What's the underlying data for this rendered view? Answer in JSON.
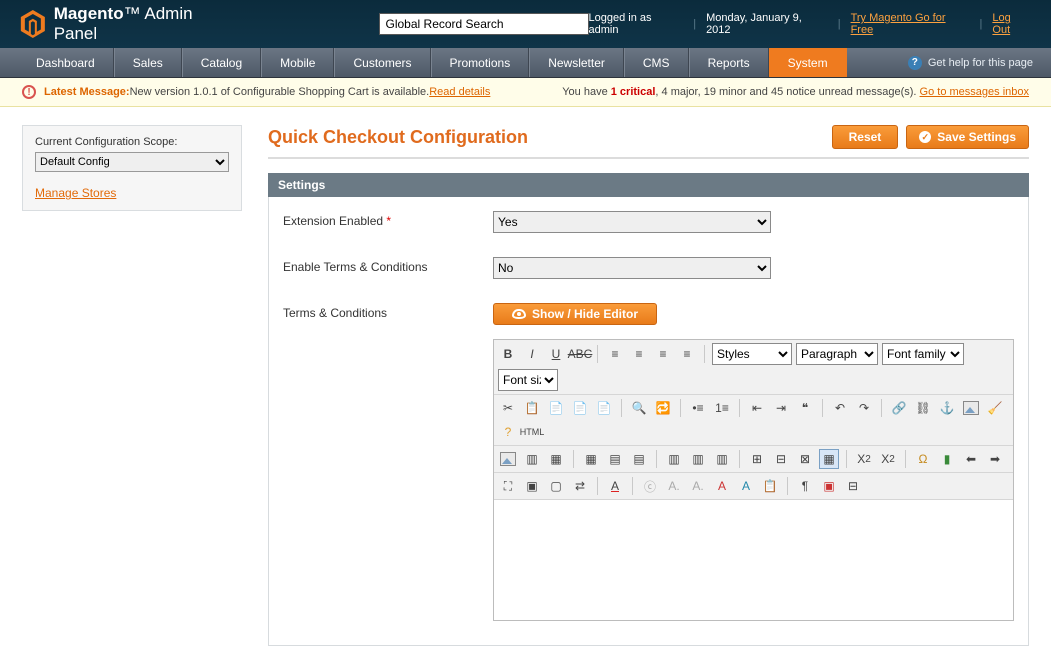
{
  "header": {
    "brand_a": "Magento",
    "brand_b": "Admin Panel",
    "search_placeholder": "Global Record Search",
    "logged_in": "Logged in as admin",
    "date": "Monday, January 9, 2012",
    "try_link": "Try Magento Go for Free",
    "logout": "Log Out"
  },
  "nav": {
    "items": [
      "Dashboard",
      "Sales",
      "Catalog",
      "Mobile",
      "Customers",
      "Promotions",
      "Newsletter",
      "CMS",
      "Reports",
      "System"
    ],
    "active_index": 9,
    "help": "Get help for this page"
  },
  "notice": {
    "prefix": "Latest Message:",
    "msg": " New version 1.0.1 of Configurable Shopping Cart is available. ",
    "details": "Read details",
    "you_have": "You have ",
    "crit_n": "1",
    "crit_t": " critical",
    "rest": ", 4 major, 19 minor and 45 notice unread message(s). ",
    "inbox": "Go to messages inbox"
  },
  "side": {
    "scope_label": "Current Configuration Scope:",
    "scope_value": "Default Config",
    "manage": "Manage Stores"
  },
  "page": {
    "title": "Quick Checkout Configuration",
    "btn_reset": "Reset",
    "btn_save": "Save Settings",
    "section": "Settings",
    "f1_label": "Extension Enabled",
    "f1_value": "Yes",
    "f2_label": "Enable Terms & Conditions",
    "f2_value": "No",
    "f3_label": "Terms & Conditions",
    "toggle_btn": "Show / Hide Editor"
  },
  "editor": {
    "styles": "Styles",
    "para": "Paragraph",
    "ffam": "Font family",
    "fsize": "Font size"
  }
}
